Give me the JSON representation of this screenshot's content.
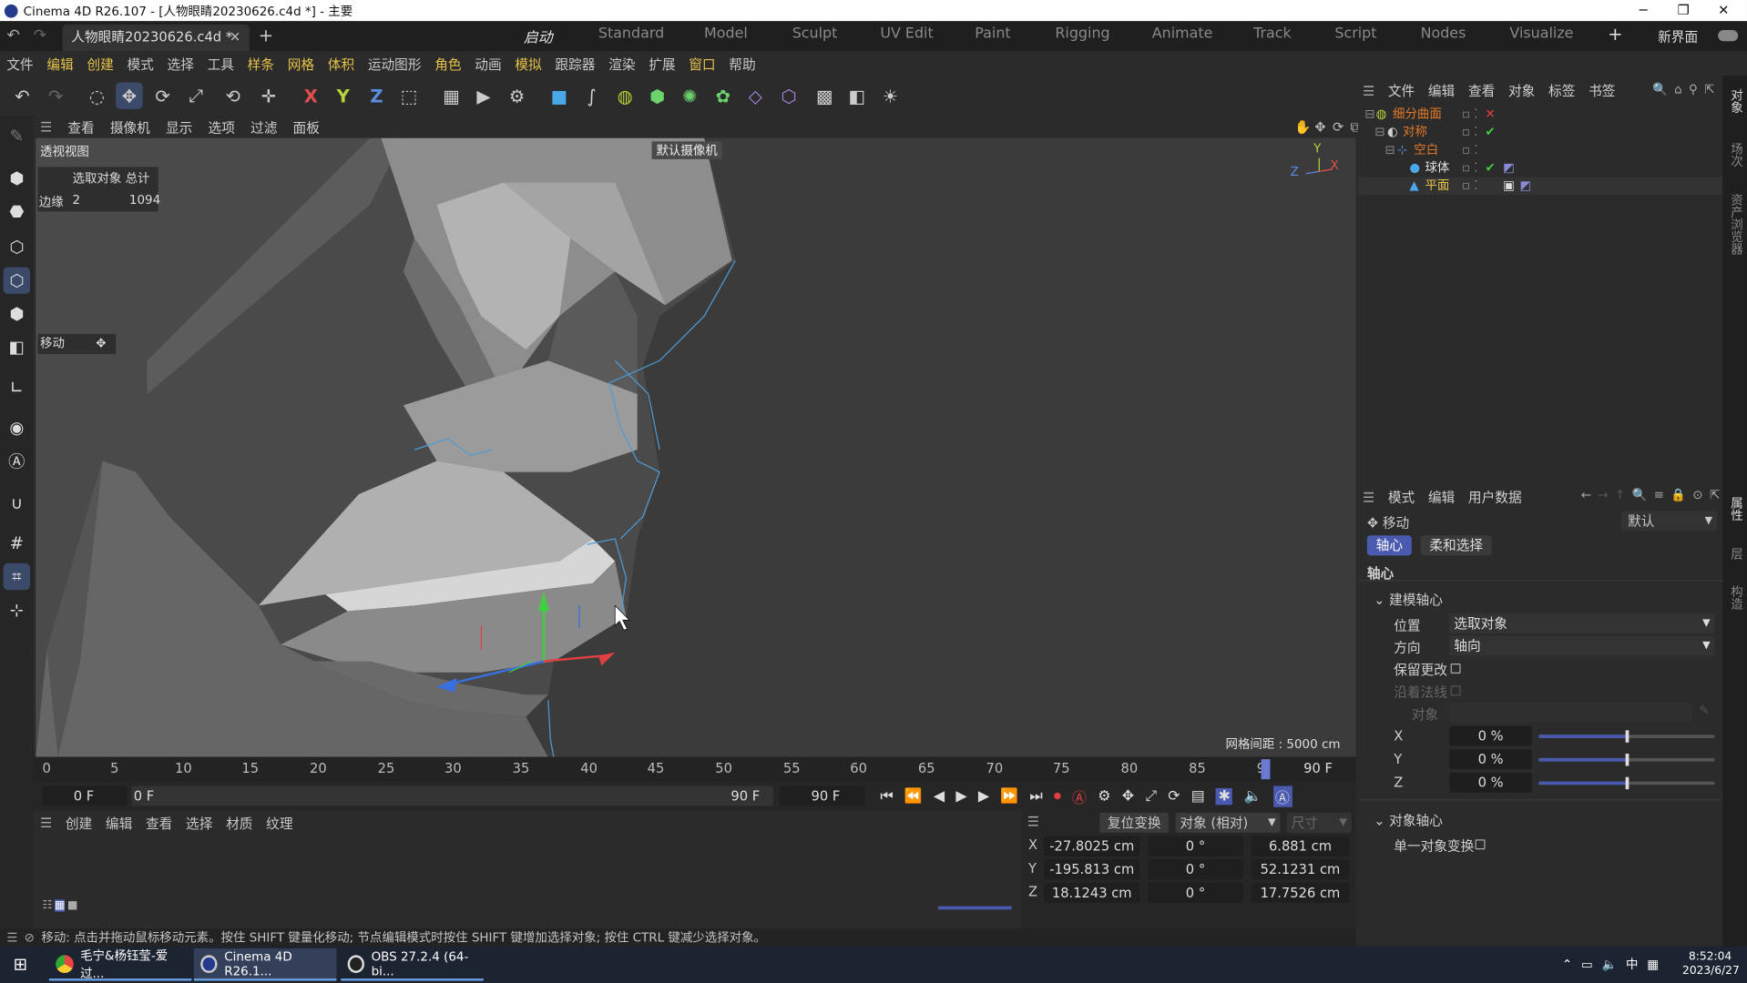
{
  "app": {
    "title": "Cinema 4D R26.107 - [人物眼睛20230626.c4d *] - 主要"
  },
  "doc_tab": {
    "label": "人物眼睛20230626.c4d *"
  },
  "layouts": [
    "启动",
    "Standard",
    "Model",
    "Sculpt",
    "UV Edit",
    "Paint",
    "Rigging",
    "Animate",
    "Track",
    "Script",
    "Nodes",
    "Visualize"
  ],
  "new_layout": "新界面",
  "menu": [
    "文件",
    "编辑",
    "创建",
    "模式",
    "选择",
    "工具",
    "样条",
    "网格",
    "体积",
    "运动图形",
    "角色",
    "动画",
    "模拟",
    "跟踪器",
    "渲染",
    "扩展",
    "窗口",
    "帮助"
  ],
  "axis_letters": {
    "x": "X",
    "y": "Y",
    "z": "Z"
  },
  "viewport_menu": [
    "查看",
    "摄像机",
    "显示",
    "选项",
    "过滤",
    "面板"
  ],
  "viewport": {
    "name": "透视视图",
    "camera": "默认摄像机",
    "stats_header": "选取对象 总计",
    "stats_label": "边缘",
    "stats_selected": "2",
    "stats_total": "1094",
    "tool_name": "移动",
    "grid_spacing": "网格间距 : 5000 cm"
  },
  "timeline": {
    "ticks": [
      "0",
      "5",
      "10",
      "15",
      "20",
      "25",
      "30",
      "35",
      "40",
      "45",
      "50",
      "55",
      "60",
      "65",
      "70",
      "75",
      "80",
      "85",
      "9"
    ],
    "end_frame": "90 F",
    "current": "0 F",
    "range_start": "0 F",
    "range_end": "90 F",
    "max": "90 F"
  },
  "material_menu": [
    "创建",
    "编辑",
    "查看",
    "选择",
    "材质",
    "纹理"
  ],
  "coords": {
    "apply": "复位变换",
    "mode": "对象 (相对)",
    "size": "尺寸",
    "rows": [
      {
        "axis": "X",
        "pos": "-27.8025 cm",
        "rot": "0 °",
        "size": "6.881 cm"
      },
      {
        "axis": "Y",
        "pos": "-195.813 cm",
        "rot": "0 °",
        "size": "52.1231 cm"
      },
      {
        "axis": "Z",
        "pos": "18.1243 cm",
        "rot": "0 °",
        "size": "17.7526 cm"
      }
    ]
  },
  "status": "移动: 点击并拖动鼠标移动元素。按住 SHIFT 键量化移动; 节点编辑模式时按住 SHIFT 键增加选择对象; 按住 CTRL 键减少选择对象。",
  "object_manager": {
    "menu": [
      "文件",
      "编辑",
      "查看",
      "对象",
      "标签",
      "书签"
    ],
    "objects": [
      {
        "name": "细分曲面",
        "color": "#e07a2a",
        "indent": 0
      },
      {
        "name": "对称",
        "color": "#e07a2a",
        "indent": 1
      },
      {
        "name": "空白",
        "color": "#e07a2a",
        "indent": 2
      },
      {
        "name": "球体",
        "color": "#e0e0e0",
        "indent": 3
      },
      {
        "name": "平面",
        "color": "#e6c24a",
        "indent": 3
      }
    ]
  },
  "attributes": {
    "menu": [
      "模式",
      "编辑",
      "用户数据"
    ],
    "tool": "移动",
    "preset": "默认",
    "tabs": [
      "轴心",
      "柔和选择"
    ],
    "section": "轴心",
    "group1": "建模轴心",
    "position_label": "位置",
    "position_value": "选取对象",
    "orientation_label": "方向",
    "orientation_value": "轴向",
    "keep_changes": "保留更改",
    "along_normal": "沿着法线",
    "object_label": "对象",
    "xyz": [
      {
        "axis": "X",
        "value": "0 %",
        "fill": 0.5
      },
      {
        "axis": "Y",
        "value": "0 %",
        "fill": 0.5
      },
      {
        "axis": "Z",
        "value": "0 %",
        "fill": 0.5
      }
    ],
    "group2": "对象轴心",
    "single_object": "单一对象变换"
  },
  "right_strip": [
    "对象",
    "场次",
    "资产浏览器",
    "属性",
    "层",
    "构造"
  ],
  "taskbar": {
    "items": [
      "毛宁&杨钰莹-爱过...",
      "Cinema 4D R26.1...",
      "OBS 27.2.4 (64-bi..."
    ],
    "time": "8:52:04",
    "date": "2023/6/27",
    "ime": "中"
  }
}
